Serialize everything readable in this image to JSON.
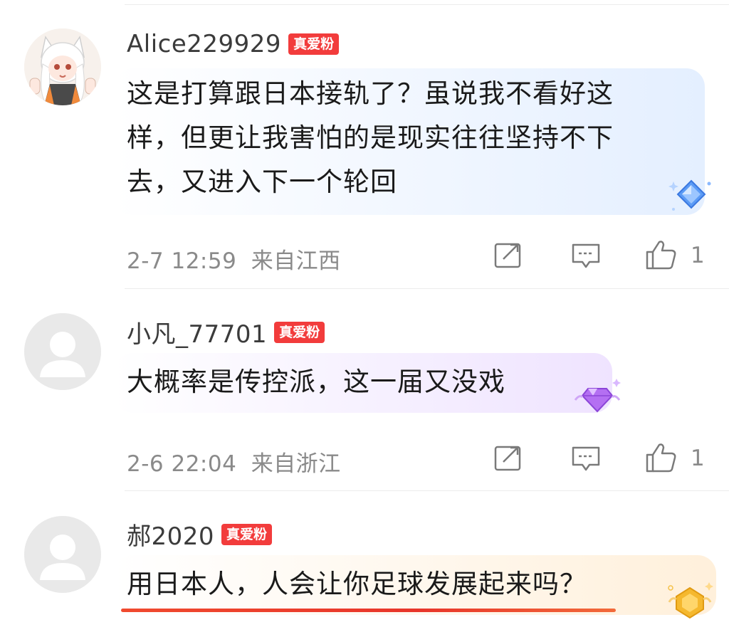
{
  "comments": [
    {
      "username": "Alice229929",
      "badge": "真爱粉",
      "text": "这是打算跟日本接轨了？虽说我不看好这\n样，但更让我害怕的是现实往往坚持不下\n去，又进入下一个轮回",
      "time": "2-7 12:59",
      "location": "来自江西",
      "likes": "1",
      "bubble_color": "#e4efff",
      "gem": "blue-diamond"
    },
    {
      "username": "小凡_77701",
      "badge": "真爱粉",
      "text": "大概率是传控派，这一届又没戏",
      "time": "2-6 22:04",
      "location": "来自浙江",
      "likes": "1",
      "bubble_color": "#efe3ff",
      "gem": "purple-diamond"
    },
    {
      "username": "郝2020",
      "badge": "真爱粉",
      "text": "用日本人，人会让你足球发展起来吗？",
      "bubble_color": "#fff0db",
      "gem": "gold-diamond"
    }
  ],
  "icons": {
    "share": "share-icon",
    "reply": "reply-icon",
    "like": "thumbs-up-icon"
  },
  "colors": {
    "badge": "#f23c3c",
    "underline": "#e8352a",
    "meta_text": "#8a8a8a"
  }
}
